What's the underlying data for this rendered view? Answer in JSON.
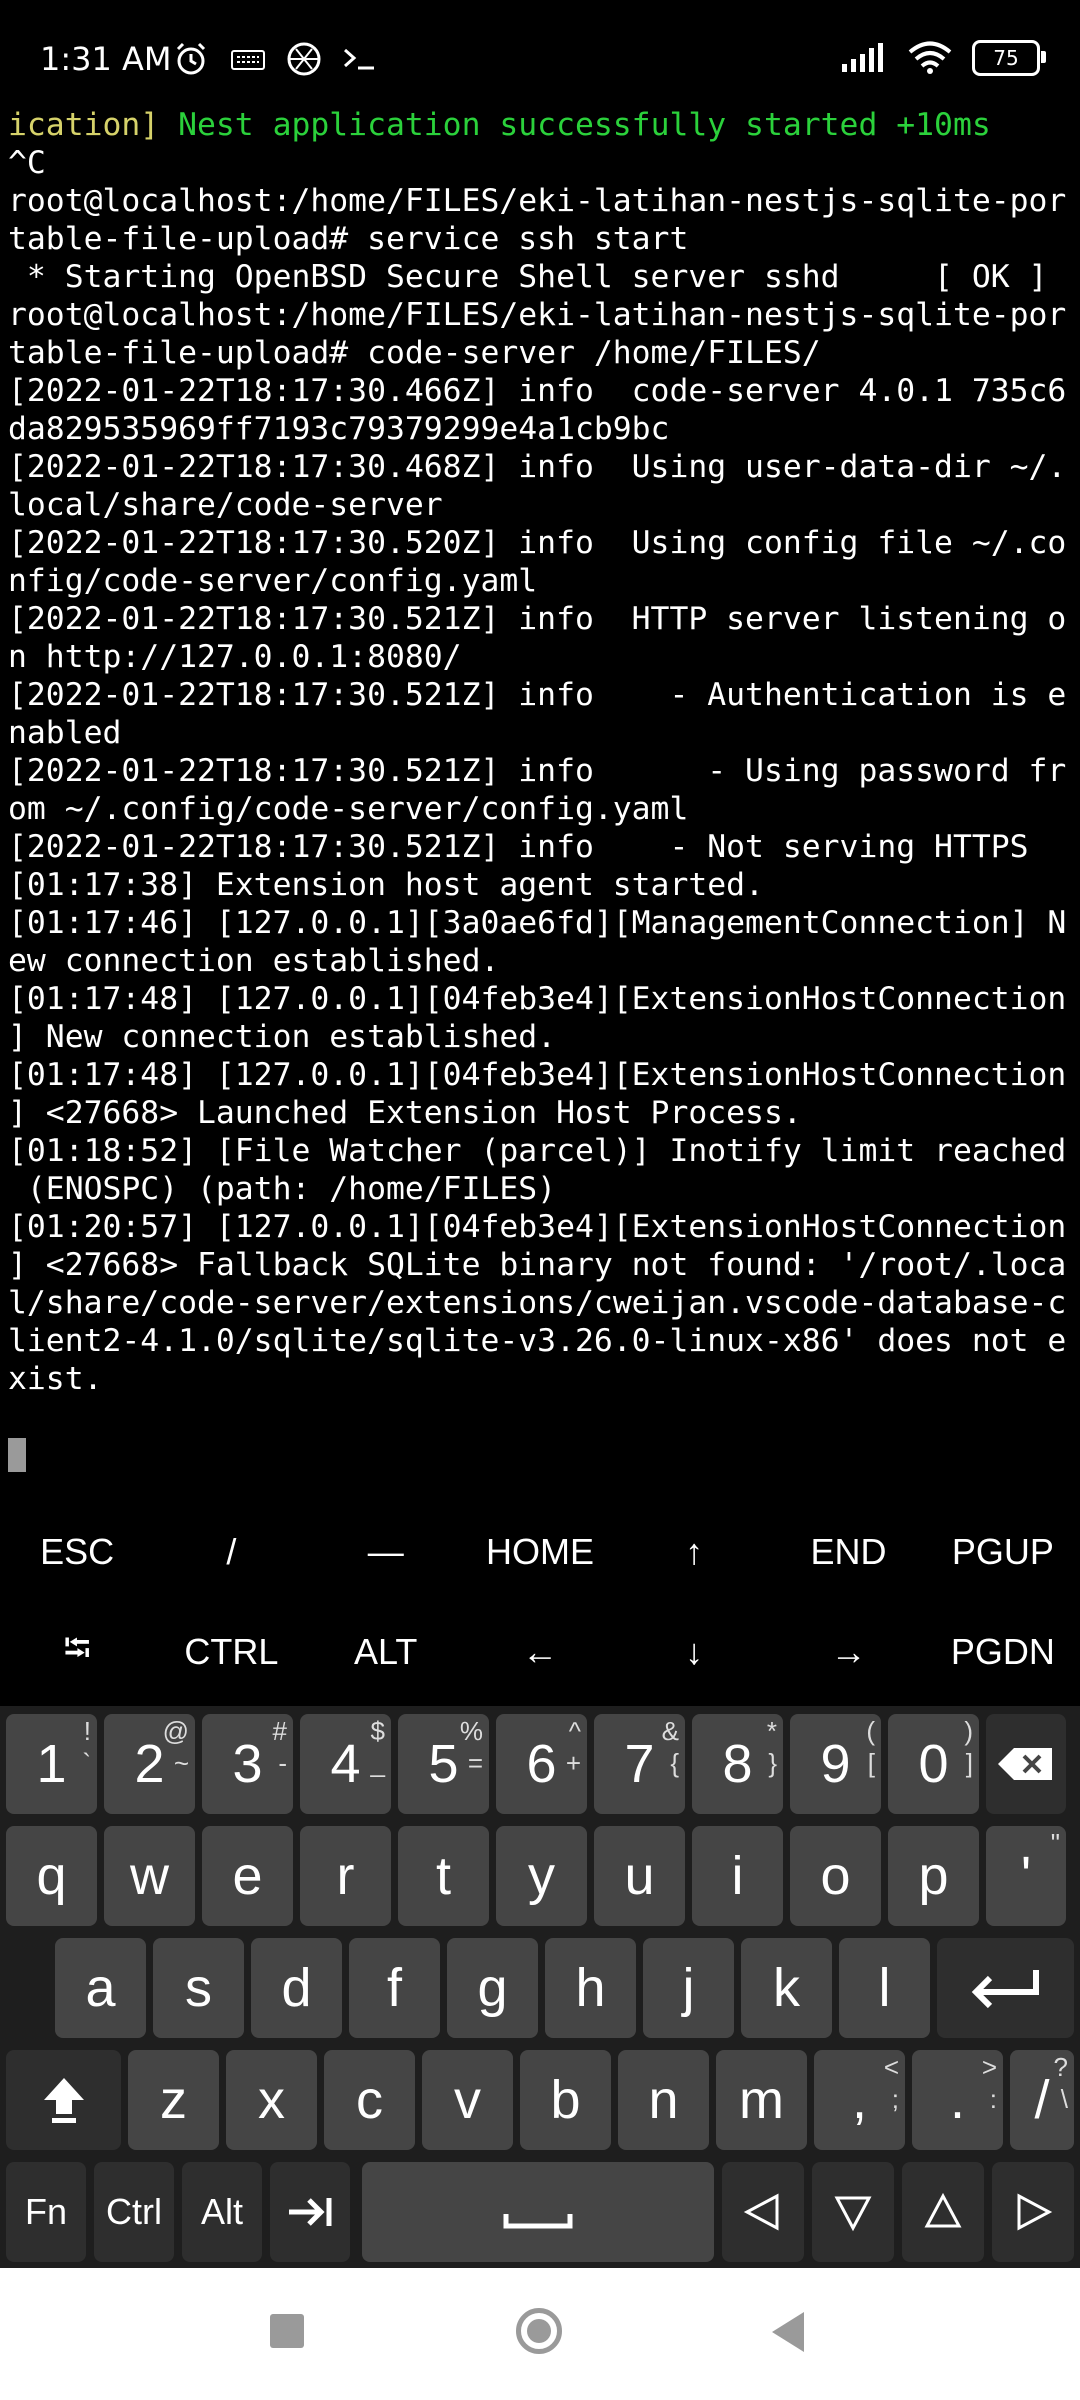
{
  "status_bar": {
    "time": "1:31 AM",
    "battery": "75",
    "left_icons": [
      "alarm-icon",
      "keyboard-icon",
      "aperture-icon",
      "terminal-icon"
    ],
    "right_icons": [
      "signal-icon",
      "wifi-icon",
      "battery-icon"
    ]
  },
  "terminal": {
    "lines": [
      "ication] Nest application successfully started +10ms",
      "^C",
      "root@localhost:/home/FILES/eki-latihan-nestjs-sqlite-por",
      "table-file-upload# service ssh start",
      " * Starting OpenBSD Secure Shell server sshd     [ OK ]",
      "root@localhost:/home/FILES/eki-latihan-nestjs-sqlite-por",
      "table-file-upload# code-server /home/FILES/",
      "[2022-01-22T18:17:30.466Z] info  code-server 4.0.1 735c6",
      "da829535969ff7193c79379299e4a1cb9bc",
      "[2022-01-22T18:17:30.468Z] info  Using user-data-dir ~/.",
      "local/share/code-server",
      "[2022-01-22T18:17:30.520Z] info  Using config file ~/.co",
      "nfig/code-server/config.yaml",
      "[2022-01-22T18:17:30.521Z] info  HTTP server listening o",
      "n http://127.0.0.1:8080/",
      "[2022-01-22T18:17:30.521Z] info    - Authentication is e",
      "nabled",
      "[2022-01-22T18:17:30.521Z] info      - Using password fr",
      "om ~/.config/code-server/config.yaml",
      "[2022-01-22T18:17:30.521Z] info    - Not serving HTTPS",
      "[01:17:38] Extension host agent started.",
      "[01:17:46] [127.0.0.1][3a0ae6fd][ManagementConnection] N",
      "ew connection established.",
      "[01:17:48] [127.0.0.1][04feb3e4][ExtensionHostConnection",
      "] New connection established.",
      "[01:17:48] [127.0.0.1][04feb3e4][ExtensionHostConnection",
      "] <27668> Launched Extension Host Process.",
      "[01:18:52] [File Watcher (parcel)] Inotify limit reached",
      " (ENOSPC) (path: /home/FILES)",
      "[01:20:57] [127.0.0.1][04feb3e4][ExtensionHostConnection",
      "] <27668> Fallback SQLite binary not found: '/root/.loca",
      "l/share/code-server/extensions/cweijan.vscode-database-c",
      "lient2-4.1.0/sqlite/sqlite-v3.26.0-linux-x86' does not e",
      "xist."
    ]
  },
  "extra_keys": {
    "row1": [
      "ESC",
      "/",
      "—",
      "HOME",
      "↑",
      "END",
      "PGUP"
    ],
    "row2": [
      "⭾",
      "CTRL",
      "ALT",
      "←",
      "↓",
      "→",
      "PGDN"
    ]
  },
  "keyboard": {
    "numbers": [
      {
        "k": "1",
        "s": "!",
        "s2": "`"
      },
      {
        "k": "2",
        "s": "@",
        "s2": "~"
      },
      {
        "k": "3",
        "s": "#",
        "s2": "-"
      },
      {
        "k": "4",
        "s": "$",
        "s2": "_"
      },
      {
        "k": "5",
        "s": "%",
        "s2": "="
      },
      {
        "k": "6",
        "s": "^",
        "s2": "+"
      },
      {
        "k": "7",
        "s": "&",
        "s2": "{"
      },
      {
        "k": "8",
        "s": "*",
        "s2": "}"
      },
      {
        "k": "9",
        "s": "(",
        "s2": "["
      },
      {
        "k": "0",
        "s": ")",
        "s2": "]"
      }
    ],
    "row_q": [
      "q",
      "w",
      "e",
      "r",
      "t",
      "y",
      "u",
      "i",
      "o",
      "p"
    ],
    "quote_key": {
      "k": "'",
      "s": "\""
    },
    "row_a": [
      "a",
      "s",
      "d",
      "f",
      "g",
      "h",
      "j",
      "k",
      "l"
    ],
    "row_z": [
      "z",
      "x",
      "c",
      "v",
      "b",
      "n",
      "m"
    ],
    "comma_key": {
      "k": ",",
      "s": "<",
      "s2": ";"
    },
    "period_key": {
      "k": ".",
      "s": ">",
      "s2": ":"
    },
    "slash_key": {
      "k": "/",
      "s": "?",
      "s2": "\\"
    },
    "fn": "Fn",
    "ctrl": "Ctrl",
    "alt": "Alt"
  },
  "colors": {
    "terminal_green": "#2bd13b",
    "terminal_yellow": "#d6d26a",
    "key_bg": "#454545",
    "keyboard_bg": "#1e1e1e"
  }
}
